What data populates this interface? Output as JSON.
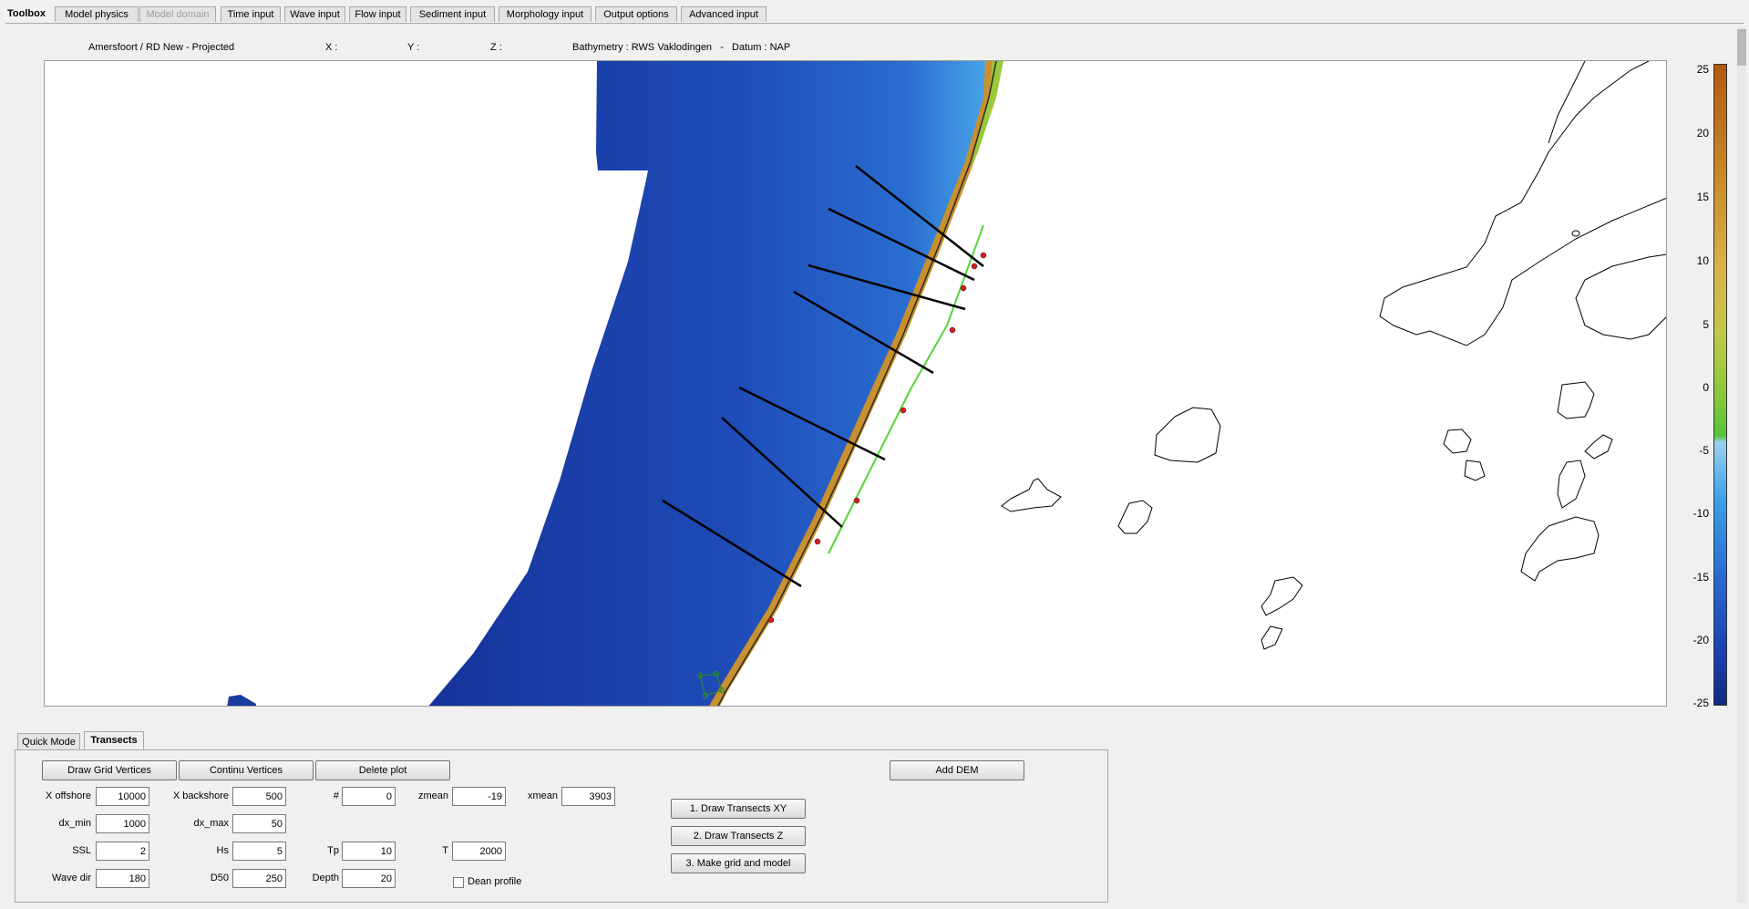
{
  "toolbox_label": "Toolbox",
  "tabs": [
    {
      "label": "Model physics",
      "enabled": true
    },
    {
      "label": "Model domain",
      "enabled": false
    },
    {
      "label": "Time input",
      "enabled": true
    },
    {
      "label": "Wave input",
      "enabled": true
    },
    {
      "label": "Flow input",
      "enabled": true
    },
    {
      "label": "Sediment input",
      "enabled": true
    },
    {
      "label": "Morphology input",
      "enabled": true
    },
    {
      "label": "Output options",
      "enabled": true
    },
    {
      "label": "Advanced input",
      "enabled": true
    }
  ],
  "info": {
    "projection": "Amersfoort / RD New - Projected",
    "x_label": "X :",
    "y_label": "Y :",
    "z_label": "Z :",
    "bathymetry": "Bathymetry : RWS Vaklodingen   -   Datum : NAP"
  },
  "colorbar": {
    "ticks": [
      "25",
      "20",
      "15",
      "10",
      "5",
      "0",
      "-5",
      "-10",
      "-15",
      "-20",
      "-25"
    ],
    "max": 25,
    "min": -25
  },
  "bottom_tabs": [
    {
      "label": "Quick Mode",
      "active": false
    },
    {
      "label": "Transects",
      "active": true
    }
  ],
  "buttons": {
    "draw_grid_vertices": "Draw Grid Vertices",
    "continu_vertices": "Continu Vertices",
    "delete_plot": "Delete plot",
    "add_dem": "Add DEM",
    "draw_transects_xy": "1. Draw Transects XY",
    "draw_transects_z": "2. Draw Transects Z",
    "make_grid_model": "3. Make grid and model"
  },
  "fields": {
    "x_offshore": {
      "label": "X offshore",
      "value": "10000"
    },
    "x_backshore": {
      "label": "X backshore",
      "value": "500"
    },
    "count": {
      "label": "#",
      "value": "0"
    },
    "zmean": {
      "label": "zmean",
      "value": "-19"
    },
    "xmean": {
      "label": "xmean",
      "value": "3903"
    },
    "dx_min": {
      "label": "dx_min",
      "value": "1000"
    },
    "dx_max": {
      "label": "dx_max",
      "value": "50"
    },
    "ssl": {
      "label": "SSL",
      "value": "2"
    },
    "hs": {
      "label": "Hs",
      "value": "5"
    },
    "tp": {
      "label": "Tp",
      "value": "10"
    },
    "t": {
      "label": "T",
      "value": "2000"
    },
    "wave_dir": {
      "label": "Wave dir",
      "value": "180"
    },
    "d50": {
      "label": "D50",
      "value": "250"
    },
    "depth": {
      "label": "Depth",
      "value": "20"
    }
  },
  "dean_profile": {
    "label": "Dean profile",
    "checked": false
  },
  "colors": {
    "deep_water": "#1a3c9e",
    "shallow_water": "#3a8ee0",
    "land_low": "#7ccc3a",
    "land_high": "#c88a2a",
    "transect": "#000000"
  }
}
